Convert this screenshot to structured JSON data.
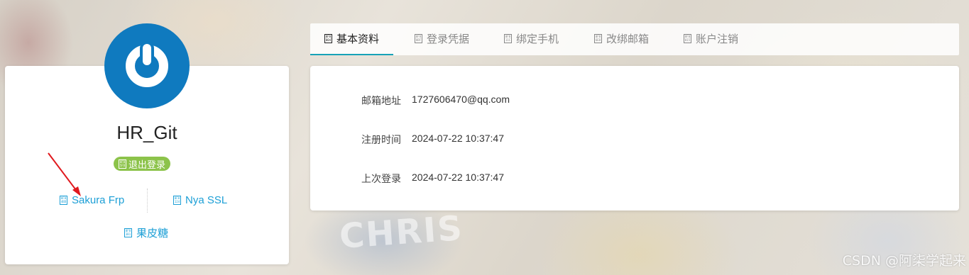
{
  "profile": {
    "username": "HR_Git",
    "logout_label": "退出登录",
    "links": {
      "sakura": "Sakura Frp",
      "nya": "Nya SSL",
      "guopitang": "果皮糖"
    }
  },
  "tabs": [
    {
      "label": "基本资料"
    },
    {
      "label": "登录凭据"
    },
    {
      "label": "绑定手机"
    },
    {
      "label": "改绑邮箱"
    },
    {
      "label": "账户注销"
    }
  ],
  "info": {
    "email_label": "邮箱地址",
    "email_value": "1727606470@qq.com",
    "registered_label": "注册时间",
    "registered_value": "2024-07-22 10:37:47",
    "last_login_label": "上次登录",
    "last_login_value": "2024-07-22 10:37:47"
  },
  "watermark": "CSDN @阿柒学起来",
  "icons": {
    "avatar": "power-icon",
    "arrow": "red-arrow-annotation"
  },
  "colors": {
    "accent": "#17a2b8",
    "link": "#1c9fd6",
    "badge": "#8cc34a",
    "avatar": "#0f7abf",
    "arrow": "#e0191e"
  }
}
